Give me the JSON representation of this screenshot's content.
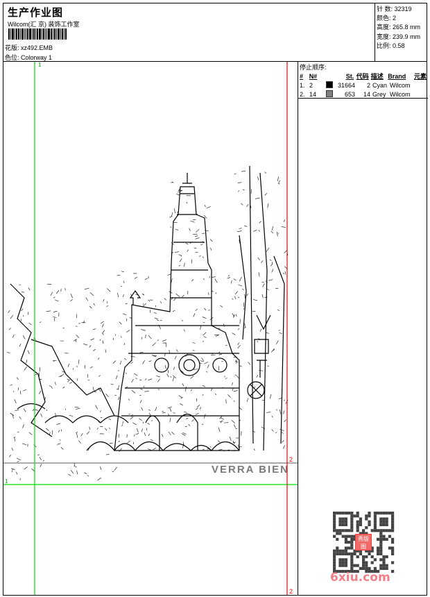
{
  "header": {
    "title": "生产作业图",
    "company": "Wilcom(汇 京) 装饰工作室",
    "design_label": "花版:",
    "design_value": "xz492.EMB",
    "colorway_label": "色位:",
    "colorway_value": "Colorway 1"
  },
  "stats": [
    {
      "label": "针 数:",
      "value": "32319"
    },
    {
      "label": "颜色:",
      "value": "2"
    },
    {
      "label": "高度:",
      "value": "265.8 mm"
    },
    {
      "label": "宽度:",
      "value": "239.9 mm"
    },
    {
      "label": "比例:",
      "value": "0.58"
    }
  ],
  "stop_sequence": {
    "title": "停止顺序:",
    "columns": [
      "#",
      "N#",
      "",
      "St.",
      "代码",
      "描述",
      "Brand",
      "元素"
    ],
    "rows": [
      {
        "idx": "1.",
        "n": "2",
        "color": "#000000",
        "st": "31664",
        "code": "2",
        "desc": "Cyan",
        "brand": "Wilcom"
      },
      {
        "idx": "2.",
        "n": "14",
        "color": "#808080",
        "st": "653",
        "code": "14",
        "desc": "Grey",
        "brand": "Wilcom"
      }
    ]
  },
  "canvas": {
    "embroidery_text": "VERRA BIEN",
    "guide_labels": [
      "1",
      "1",
      "2",
      "2"
    ],
    "guide_colors": {
      "green": "#00e000",
      "red": "#ff0000"
    }
  },
  "watermark": {
    "site": "6xiu.com",
    "seal": "秀版图"
  }
}
